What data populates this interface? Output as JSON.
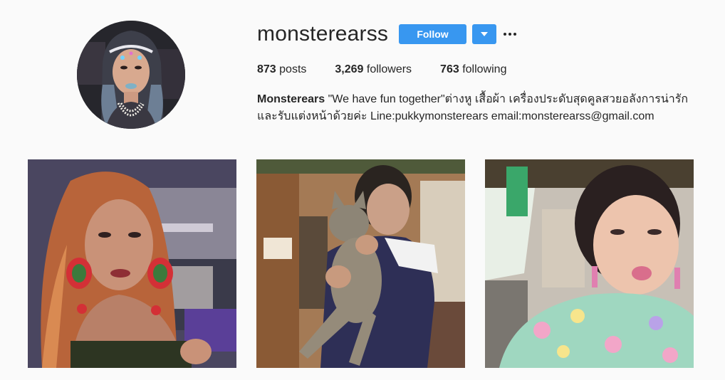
{
  "profile": {
    "username": "monsterearss",
    "follow_label": "Follow"
  },
  "stats": {
    "posts_count": "873",
    "posts_label": "posts",
    "followers_count": "3,269",
    "followers_label": "followers",
    "following_count": "763",
    "following_label": "following"
  },
  "bio": {
    "name": "Monsterears",
    "line1": " \"We have fun together\"ต่างหู เสื้อผ้า เครื่องประดับสุดคูลสวยอลังการน่ารัก",
    "line2": "และรับแต่งหน้าด้วยค่ะ Line:pukkymonsterears email:monsterearss@gmail.com"
  },
  "colors": {
    "accent": "#3897f0",
    "text": "#262626",
    "background": "#fafafa"
  },
  "icons": {
    "dropdown": "chevron-down-icon",
    "more": "more-options-icon"
  }
}
